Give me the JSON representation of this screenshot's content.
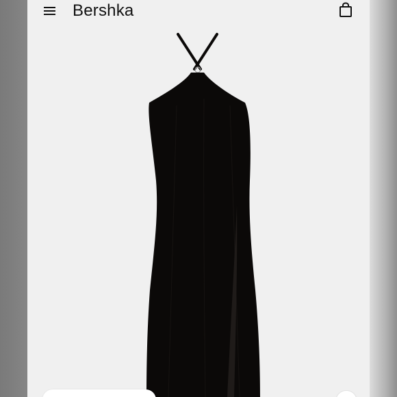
{
  "header": {
    "brand": "Bershka",
    "menu_icon": "hamburger-menu-icon",
    "cart_icon": "shopping-bag-icon"
  },
  "product": {
    "image_subject": "black-halter-midi-dress",
    "garment_color": "#0b0908",
    "background_color": "#f0f0f0"
  },
  "bottom_controls": {
    "pill_button_label": "",
    "favorite_icon": "heart-icon"
  }
}
